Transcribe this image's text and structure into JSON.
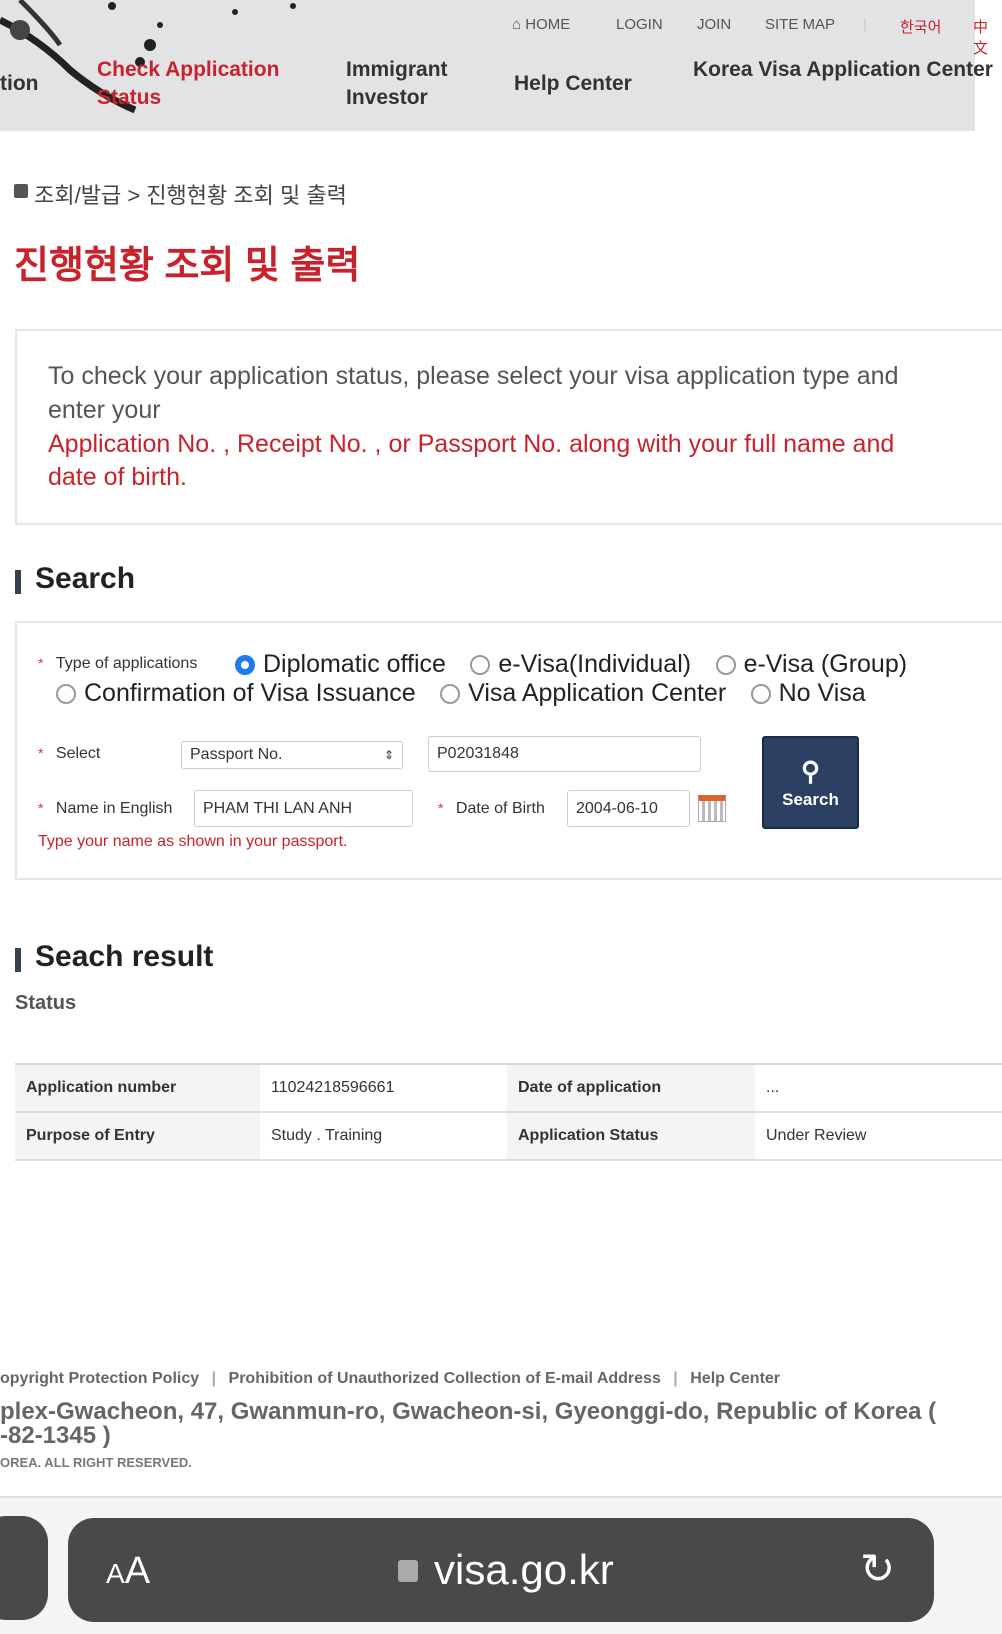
{
  "header": {
    "top_links": {
      "home": "HOME",
      "login": "LOGIN",
      "join": "JOIN",
      "sitemap": "SITE MAP",
      "korean": "한국어",
      "chinese": "中文"
    },
    "nav": {
      "partial": "tion",
      "check_1": "Check Application",
      "check_2": "Status",
      "immigrant_1": "Immigrant",
      "immigrant_2": "Investor",
      "help": "Help Center",
      "kvac": "Korea Visa Application Center"
    }
  },
  "breadcrumb": {
    "item1": "조회/발급",
    "sep": ">",
    "item2": "진행현황 조회 및 출력"
  },
  "page_title": "진행현황 조회 및 출력",
  "notice": {
    "line1": "To check your application status, please select your visa application type and",
    "line2": "enter your",
    "line3": "Application No. , Receipt No. , or Passport No. along with your full name and",
    "line4": "date of birth."
  },
  "search": {
    "heading": "Search",
    "type_label": "Type of applications",
    "types": [
      {
        "label": "Diplomatic office",
        "selected": true
      },
      {
        "label": "e-Visa(Individual)",
        "selected": false
      },
      {
        "label": "e-Visa (Group)",
        "selected": false
      },
      {
        "label": "Confirmation of Visa Issuance",
        "selected": false
      },
      {
        "label": "Visa Application Center",
        "selected": false
      },
      {
        "label": "No Visa",
        "selected": false
      }
    ],
    "select_label": "Select",
    "select_value": "Passport No.",
    "number_value": "P02031848",
    "name_label": "Name in English",
    "name_value": "PHAM THI LAN ANH",
    "dob_label": "Date of Birth",
    "dob_value": "2004-06-10",
    "hint": "Type your name as shown in your passport.",
    "button": "Search"
  },
  "result": {
    "heading": "Seach result",
    "subheading": "Status",
    "rows": [
      [
        "Application number",
        "11024218596661",
        "Date of application",
        "..."
      ],
      [
        "Purpose of Entry",
        "Study . Training",
        "Application Status",
        "Under Review"
      ]
    ]
  },
  "footer": {
    "links": [
      "opyright Protection Policy",
      "Prohibition of Unauthorized Collection of E-mail Address",
      "Help Center"
    ],
    "address1": "plex-Gwacheon, 47, Gwanmun-ro, Gwacheon-si, Gyeonggi-do, Republic of Korea (",
    "address2": "-82-1345 )",
    "copyright": "OREA. ALL RIGHT RESERVED."
  },
  "browser": {
    "text_size": "AA",
    "url": "visa.go.kr"
  },
  "colors": {
    "accent_red": "#c8232c",
    "button_blue": "#2b4063",
    "radio_blue": "#1e7cf2"
  }
}
